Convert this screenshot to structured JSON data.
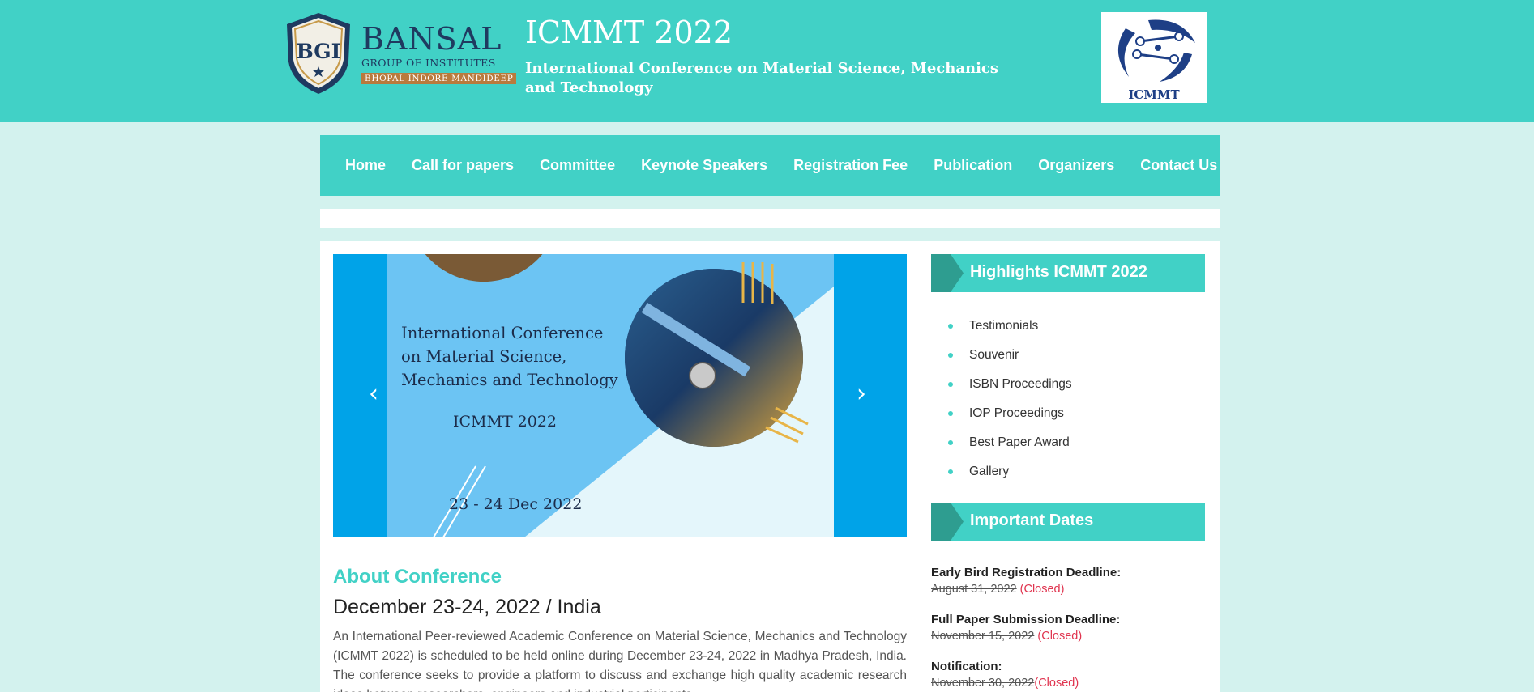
{
  "header": {
    "bgi": {
      "name": "BANSAL",
      "subtitle": "GROUP OF INSTITUTES",
      "locations": "BHOPAL INDORE MANDIDEEP",
      "shield_text": "BGI"
    },
    "title": "ICMMT 2022",
    "subtitle": "International Conference on Material Science, Mechanics and Technology",
    "icmmt_logo_text": "ICMMT"
  },
  "nav": {
    "items": [
      {
        "label": "Home"
      },
      {
        "label": "Call for papers"
      },
      {
        "label": "Committee"
      },
      {
        "label": "Keynote Speakers"
      },
      {
        "label": "Registration Fee"
      },
      {
        "label": "Publication"
      },
      {
        "label": "Organizers"
      },
      {
        "label": "Contact Us"
      }
    ]
  },
  "carousel": {
    "line1": "International Conference",
    "line2": "on Material Science,",
    "line3": "Mechanics and Technology",
    "code": "ICMMT 2022",
    "date": "23 - 24 Dec 2022",
    "prev_icon": "chevron-left-icon",
    "next_icon": "chevron-right-icon"
  },
  "about": {
    "heading": "About Conference",
    "date_location": "December 23-24, 2022 / India",
    "text": "An International Peer-reviewed Academic Conference on Material Science, Mechanics and Technology (ICMMT 2022) is scheduled to be held online during December 23-24, 2022 in Madhya Pradesh, India. The conference seeks to provide a platform to discuss and exchange high quality academic research ideas between researchers, engineers and industrial participants."
  },
  "sidebar": {
    "highlights_heading": "Highlights ICMMT 2022",
    "highlights": [
      {
        "label": "Testimonials"
      },
      {
        "label": "Souvenir"
      },
      {
        "label": "ISBN Proceedings"
      },
      {
        "label": "IOP Proceedings"
      },
      {
        "label": "Best Paper Award"
      },
      {
        "label": "Gallery"
      }
    ],
    "dates_heading": "Important Dates",
    "dates": [
      {
        "label": "Early Bird Registration Deadline:",
        "date": "August 31, 2022",
        "status": " (Closed)"
      },
      {
        "label": "Full Paper Submission Deadline:",
        "date": "November 15, 2022",
        "status": " (Closed)"
      },
      {
        "label": "Notification:",
        "date": "November 30, 2022",
        "status": "(Closed)"
      }
    ]
  },
  "colors": {
    "accent": "#41d1c6",
    "accent_dark": "#2e9d90",
    "page_bg": "#d3f2ee",
    "closed": "#e0344f",
    "carousel_blue": "#00a3e8"
  }
}
